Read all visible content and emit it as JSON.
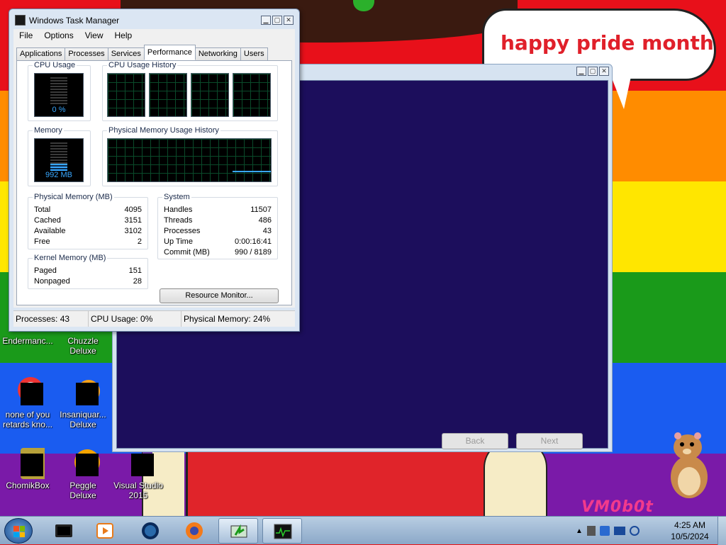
{
  "desktop": {
    "bubble_text": "happy pride month",
    "watermark": "VM0b0t",
    "icons": [
      {
        "label": "Endermanc..."
      },
      {
        "label": "Chuzzle Deluxe"
      },
      {
        "label": "none of you retards kno..."
      },
      {
        "label": "Insaniquar... Deluxe"
      },
      {
        "label": "ChomikBox"
      },
      {
        "label": "Peggle Deluxe"
      },
      {
        "label": "Visual Studio 2015"
      }
    ]
  },
  "wizard": {
    "back_label": "Back",
    "next_label": "Next"
  },
  "task_manager": {
    "title": "Windows Task Manager",
    "menu": [
      "File",
      "Options",
      "View",
      "Help"
    ],
    "tabs": [
      "Applications",
      "Processes",
      "Services",
      "Performance",
      "Networking",
      "Users"
    ],
    "active_tab": "Performance",
    "cpu_usage_label": "CPU Usage",
    "cpu_usage_value": "0 %",
    "cpu_usage_fraction": 0.0,
    "cpu_history_label": "CPU Usage History",
    "memory_label": "Memory",
    "memory_value": "992 MB",
    "memory_fraction": 0.24,
    "mem_history_label": "Physical Memory Usage History",
    "physical_memory": {
      "title": "Physical Memory (MB)",
      "rows": [
        {
          "k": "Total",
          "v": "4095"
        },
        {
          "k": "Cached",
          "v": "3151"
        },
        {
          "k": "Available",
          "v": "3102"
        },
        {
          "k": "Free",
          "v": "2"
        }
      ]
    },
    "kernel_memory": {
      "title": "Kernel Memory (MB)",
      "rows": [
        {
          "k": "Paged",
          "v": "151"
        },
        {
          "k": "Nonpaged",
          "v": "28"
        }
      ]
    },
    "system": {
      "title": "System",
      "rows": [
        {
          "k": "Handles",
          "v": "11507"
        },
        {
          "k": "Threads",
          "v": "486"
        },
        {
          "k": "Processes",
          "v": "43"
        },
        {
          "k": "Up Time",
          "v": "0:00:16:41"
        },
        {
          "k": "Commit (MB)",
          "v": "990 / 8189"
        }
      ]
    },
    "resource_monitor_label": "Resource Monitor...",
    "status": {
      "processes": "Processes: 43",
      "cpu": "CPU Usage: 0%",
      "memory": "Physical Memory: 24%"
    }
  },
  "taskbar": {
    "time": "4:25 AM",
    "date": "10/5/2024"
  }
}
